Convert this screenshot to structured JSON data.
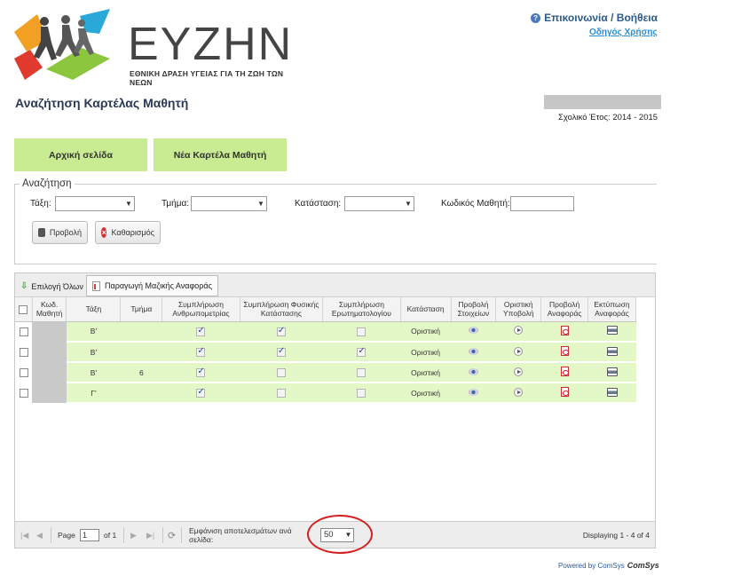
{
  "header": {
    "logo_word": "ΕΥΖΗΝ",
    "logo_subtitle": "ΕΘΝΙΚΗ ΔΡΑΣΗ ΥΓΕΙΑΣ ΓΙΑ ΤΗ ΖΩΗ ΤΩΝ ΝΕΩΝ",
    "contact": "Επικοινωνία / Βοήθεια",
    "guide": "Οδηγός Χρήσης"
  },
  "page": {
    "title": "Αναζήτηση Καρτέλας Μαθητή",
    "school_year": "Σχολικό Έτος: 2014 - 2015"
  },
  "buttons": {
    "home": "Αρχική σελίδα",
    "new_card": "Νέα Καρτέλα Μαθητή"
  },
  "search": {
    "legend": "Αναζήτηση",
    "class_label": "Τάξη:",
    "section_label": "Τμήμα:",
    "status_label": "Κατάσταση:",
    "code_label": "Κωδικός Μαθητή:",
    "view_label": "Προβολή",
    "clear_label": "Καθαρισμός"
  },
  "grid": {
    "select_all": "Επιλογή Όλων",
    "mass_report": "Παραγωγή Μαζικής Αναφοράς",
    "columns": {
      "code": "Κωδ. Μαθητή",
      "class": "Τάξη",
      "section": "Τμήμα",
      "anthro": "Συμπλήρωση Ανθρωπομετρίας",
      "physical": "Συμπλήρωση Φυσικής Κατάστασης",
      "questionnaire": "Συμπλήρωση Ερωτηματολογίου",
      "status": "Κατάσταση",
      "view_details": "Προβολή Στοιχείων",
      "final_submit": "Οριστική Υποβολή",
      "view_report": "Προβολή Αναφοράς",
      "print_report": "Εκτύπωση Αναφοράς"
    },
    "rows": [
      {
        "class": "Β'",
        "section": "",
        "anthro": true,
        "physical": true,
        "questionnaire": false,
        "status": "Οριστική"
      },
      {
        "class": "Β'",
        "section": "",
        "anthro": true,
        "physical": true,
        "questionnaire": true,
        "status": "Οριστική"
      },
      {
        "class": "Β'",
        "section": "6",
        "anthro": true,
        "physical": false,
        "questionnaire": false,
        "status": "Οριστική"
      },
      {
        "class": "Γ'",
        "section": "",
        "anthro": true,
        "physical": false,
        "questionnaire": false,
        "status": "Οριστική"
      }
    ]
  },
  "pager": {
    "page_label": "Page",
    "page_value": "1",
    "of_label": "of 1",
    "per_page_label": "Εμφάνιση αποτελεσμάτων ανά σελίδα:",
    "per_page_value": "50",
    "displaying": "Displaying 1 - 4 of 4"
  },
  "footer": {
    "powered": "Powered by ComSys",
    "comsys_logo": "COMSYS"
  }
}
